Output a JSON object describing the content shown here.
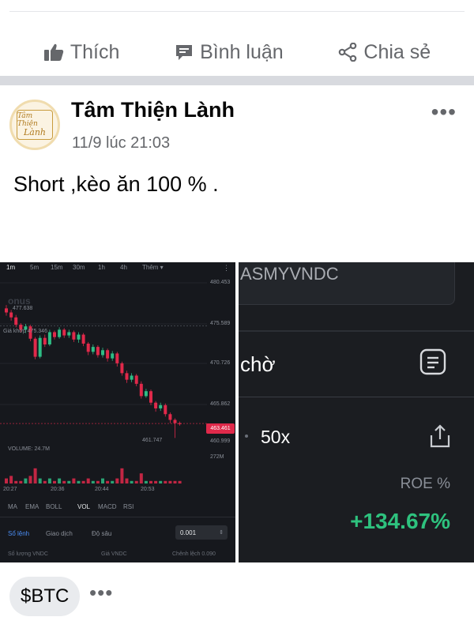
{
  "actions": {
    "like": "Thích",
    "comment": "Bình luận",
    "share": "Chia sẻ"
  },
  "post": {
    "author": "Tâm Thiện Lành",
    "time": "11/9 lúc 21:03",
    "text": "Short ,kèo ăn 100 % .",
    "more": "•••",
    "avatar_text": {
      "line1": "Tâm Thiện",
      "line2": "Lành"
    }
  },
  "chart_image": {
    "timeframes": [
      "1m",
      "5m",
      "15m",
      "30m",
      "1h",
      "4h",
      "Thêm ▾"
    ],
    "active_timeframe": "1m",
    "watermark": "onus",
    "high_label": "477.638",
    "entry_label": "Giá khớp 475.346",
    "price_axis": [
      "480.453",
      "475.589",
      "470.726",
      "465.862",
      "463.461",
      "460.999",
      "272M"
    ],
    "current_price": "463.461",
    "low_label": "461.747",
    "volume_label": "VOLUME: 24.7M",
    "time_axis": [
      "20:27",
      "20:36",
      "20:44",
      "20:53"
    ],
    "indicators": [
      "MA",
      "EMA",
      "BOLL",
      "VOL",
      "MACD",
      "RSI"
    ],
    "active_indicator": "VOL",
    "tabs": [
      "Sổ lệnh",
      "Giao dịch",
      "Độ sâu"
    ],
    "quantity": "0.001",
    "bottom_labels": [
      "Số lượng VNDC",
      "Giá VNDC",
      "Chênh lệch 0.090"
    ],
    "candles": [
      {
        "o": 477.5,
        "c": 477.0,
        "h": 477.9,
        "l": 476.6
      },
      {
        "o": 477.0,
        "c": 476.4,
        "h": 477.3,
        "l": 476.0
      },
      {
        "o": 476.4,
        "c": 475.5,
        "h": 476.7,
        "l": 475.2
      },
      {
        "o": 475.5,
        "c": 474.9,
        "h": 475.7,
        "l": 474.6
      },
      {
        "o": 474.9,
        "c": 475.3,
        "h": 475.6,
        "l": 474.5
      },
      {
        "o": 475.3,
        "c": 473.8,
        "h": 475.5,
        "l": 473.5
      },
      {
        "o": 473.8,
        "c": 471.6,
        "h": 474.0,
        "l": 471.3
      },
      {
        "o": 471.6,
        "c": 473.9,
        "h": 474.2,
        "l": 471.4
      },
      {
        "o": 473.9,
        "c": 473.1,
        "h": 474.3,
        "l": 472.8
      },
      {
        "o": 473.1,
        "c": 474.6,
        "h": 474.9,
        "l": 472.9
      },
      {
        "o": 474.6,
        "c": 474.0,
        "h": 474.8,
        "l": 473.7
      },
      {
        "o": 474.0,
        "c": 474.9,
        "h": 475.2,
        "l": 473.8
      },
      {
        "o": 474.9,
        "c": 474.2,
        "h": 475.1,
        "l": 473.9
      },
      {
        "o": 474.2,
        "c": 474.6,
        "h": 474.9,
        "l": 473.9
      },
      {
        "o": 474.6,
        "c": 473.7,
        "h": 474.8,
        "l": 473.4
      },
      {
        "o": 473.7,
        "c": 474.3,
        "h": 474.6,
        "l": 473.3
      },
      {
        "o": 474.3,
        "c": 473.2,
        "h": 474.5,
        "l": 472.9
      },
      {
        "o": 473.2,
        "c": 472.2,
        "h": 473.4,
        "l": 471.8
      },
      {
        "o": 472.2,
        "c": 472.8,
        "h": 473.1,
        "l": 471.9
      },
      {
        "o": 472.8,
        "c": 471.8,
        "h": 473.0,
        "l": 471.5
      },
      {
        "o": 471.8,
        "c": 472.4,
        "h": 472.7,
        "l": 471.5
      },
      {
        "o": 472.4,
        "c": 471.4,
        "h": 472.6,
        "l": 471.0
      },
      {
        "o": 471.4,
        "c": 472.0,
        "h": 472.3,
        "l": 471.1
      },
      {
        "o": 472.0,
        "c": 470.8,
        "h": 472.2,
        "l": 470.4
      },
      {
        "o": 470.8,
        "c": 469.6,
        "h": 471.0,
        "l": 469.3
      },
      {
        "o": 469.6,
        "c": 468.8,
        "h": 469.9,
        "l": 468.4
      },
      {
        "o": 468.8,
        "c": 469.3,
        "h": 469.6,
        "l": 468.5
      },
      {
        "o": 469.3,
        "c": 468.3,
        "h": 469.5,
        "l": 468.0
      },
      {
        "o": 468.3,
        "c": 466.8,
        "h": 468.6,
        "l": 466.5
      },
      {
        "o": 466.8,
        "c": 467.4,
        "h": 467.7,
        "l": 466.6
      },
      {
        "o": 467.4,
        "c": 466.0,
        "h": 467.6,
        "l": 465.7
      },
      {
        "o": 466.0,
        "c": 465.3,
        "h": 466.2,
        "l": 464.9
      },
      {
        "o": 465.3,
        "c": 465.7,
        "h": 466.0,
        "l": 465.0
      },
      {
        "o": 465.7,
        "c": 464.6,
        "h": 465.9,
        "l": 464.3
      },
      {
        "o": 464.6,
        "c": 463.9,
        "h": 464.8,
        "l": 463.5
      },
      {
        "o": 463.9,
        "c": 463.5,
        "h": 464.1,
        "l": 461.7
      },
      {
        "o": 463.5,
        "c": 463.461,
        "h": 463.7,
        "l": 463.2
      }
    ],
    "volumes": [
      2,
      3,
      1,
      1,
      2,
      3,
      6,
      2,
      1,
      2,
      1,
      2,
      1,
      1,
      2,
      1,
      1,
      2,
      1,
      1,
      2,
      1,
      1,
      2,
      6,
      2,
      1,
      1,
      4,
      1,
      1,
      1,
      1,
      1,
      1,
      1,
      1
    ]
  },
  "right_image": {
    "symbol": "ASMYVNDC",
    "pending": "chờ",
    "leverage": "50x",
    "roe_label": "ROE %",
    "roe_value": "+134.67%"
  },
  "tag": "$BTC",
  "bottom_more": "•••",
  "colors": {
    "up": "#2ebd85",
    "down": "#e0294a",
    "roe": "#2ec27e",
    "accent": "#4b8ef5"
  }
}
